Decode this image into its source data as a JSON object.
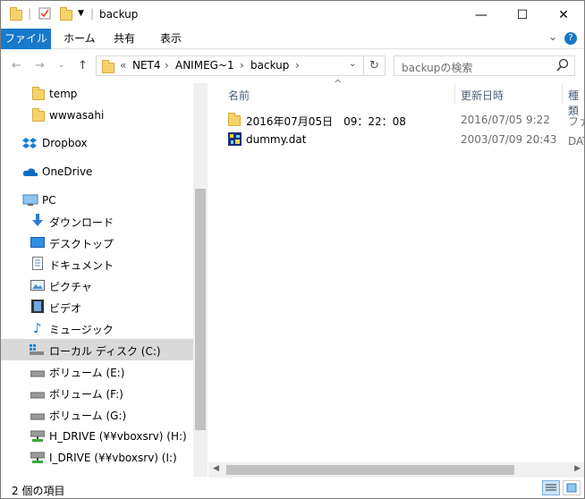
{
  "title_bar": {
    "title": "backup",
    "quick_access_separator": "|",
    "minimize": "—",
    "maximize": "☐",
    "close": "✕"
  },
  "ribbon": {
    "tabs": [
      "ファイル",
      "ホーム",
      "共有",
      "表示"
    ],
    "collapse": "⌄",
    "help": "?"
  },
  "address_bar": {
    "overflow": "«",
    "crumbs": [
      "NET4",
      "ANIMEG~1",
      "backup"
    ],
    "sep": "›",
    "dropdown": "⌄",
    "refresh": "↻",
    "search_placeholder": "backupの検索"
  },
  "nav_pane": {
    "items": [
      {
        "label": "temp",
        "icon": "folder-icon"
      },
      {
        "label": "wwwasahi",
        "icon": "folder-icon"
      },
      {
        "label": "Dropbox",
        "icon": "dropbox-icon"
      },
      {
        "label": "OneDrive",
        "icon": "cloud-icon"
      },
      {
        "label": "PC",
        "icon": "pc-icon"
      },
      {
        "label": "ダウンロード",
        "icon": "download-icon"
      },
      {
        "label": "デスクトップ",
        "icon": "desktop-icon"
      },
      {
        "label": "ドキュメント",
        "icon": "document-icon"
      },
      {
        "label": "ピクチャ",
        "icon": "picture-icon"
      },
      {
        "label": "ビデオ",
        "icon": "video-icon"
      },
      {
        "label": "ミュージック",
        "icon": "music-icon"
      },
      {
        "label": "ローカル ディスク (C:)",
        "icon": "local-disk-icon"
      },
      {
        "label": "ボリューム (E:)",
        "icon": "drive-icon"
      },
      {
        "label": "ボリューム (F:)",
        "icon": "drive-icon"
      },
      {
        "label": "ボリューム (G:)",
        "icon": "drive-icon"
      },
      {
        "label": "H_DRIVE (¥¥vboxsrv) (H:)",
        "icon": "network-drive-icon"
      },
      {
        "label": "I_DRIVE (¥¥vboxsrv) (I:)",
        "icon": "network-drive-icon"
      }
    ]
  },
  "columns": {
    "sort_arrow": "^",
    "name": "名前",
    "date": "更新日時",
    "type": "種類"
  },
  "files": [
    {
      "name": "2016年07月05日　09：22：08",
      "date": "2016/07/05 9:22",
      "type": "ファイル フォルダー",
      "icon": "folder-icon"
    },
    {
      "name": "dummy.dat",
      "date": "2003/07/09 20:43",
      "type": "DAT ファイル",
      "icon": "dat-file-icon"
    }
  ],
  "status_bar": {
    "item_count": "2 個の項目"
  }
}
